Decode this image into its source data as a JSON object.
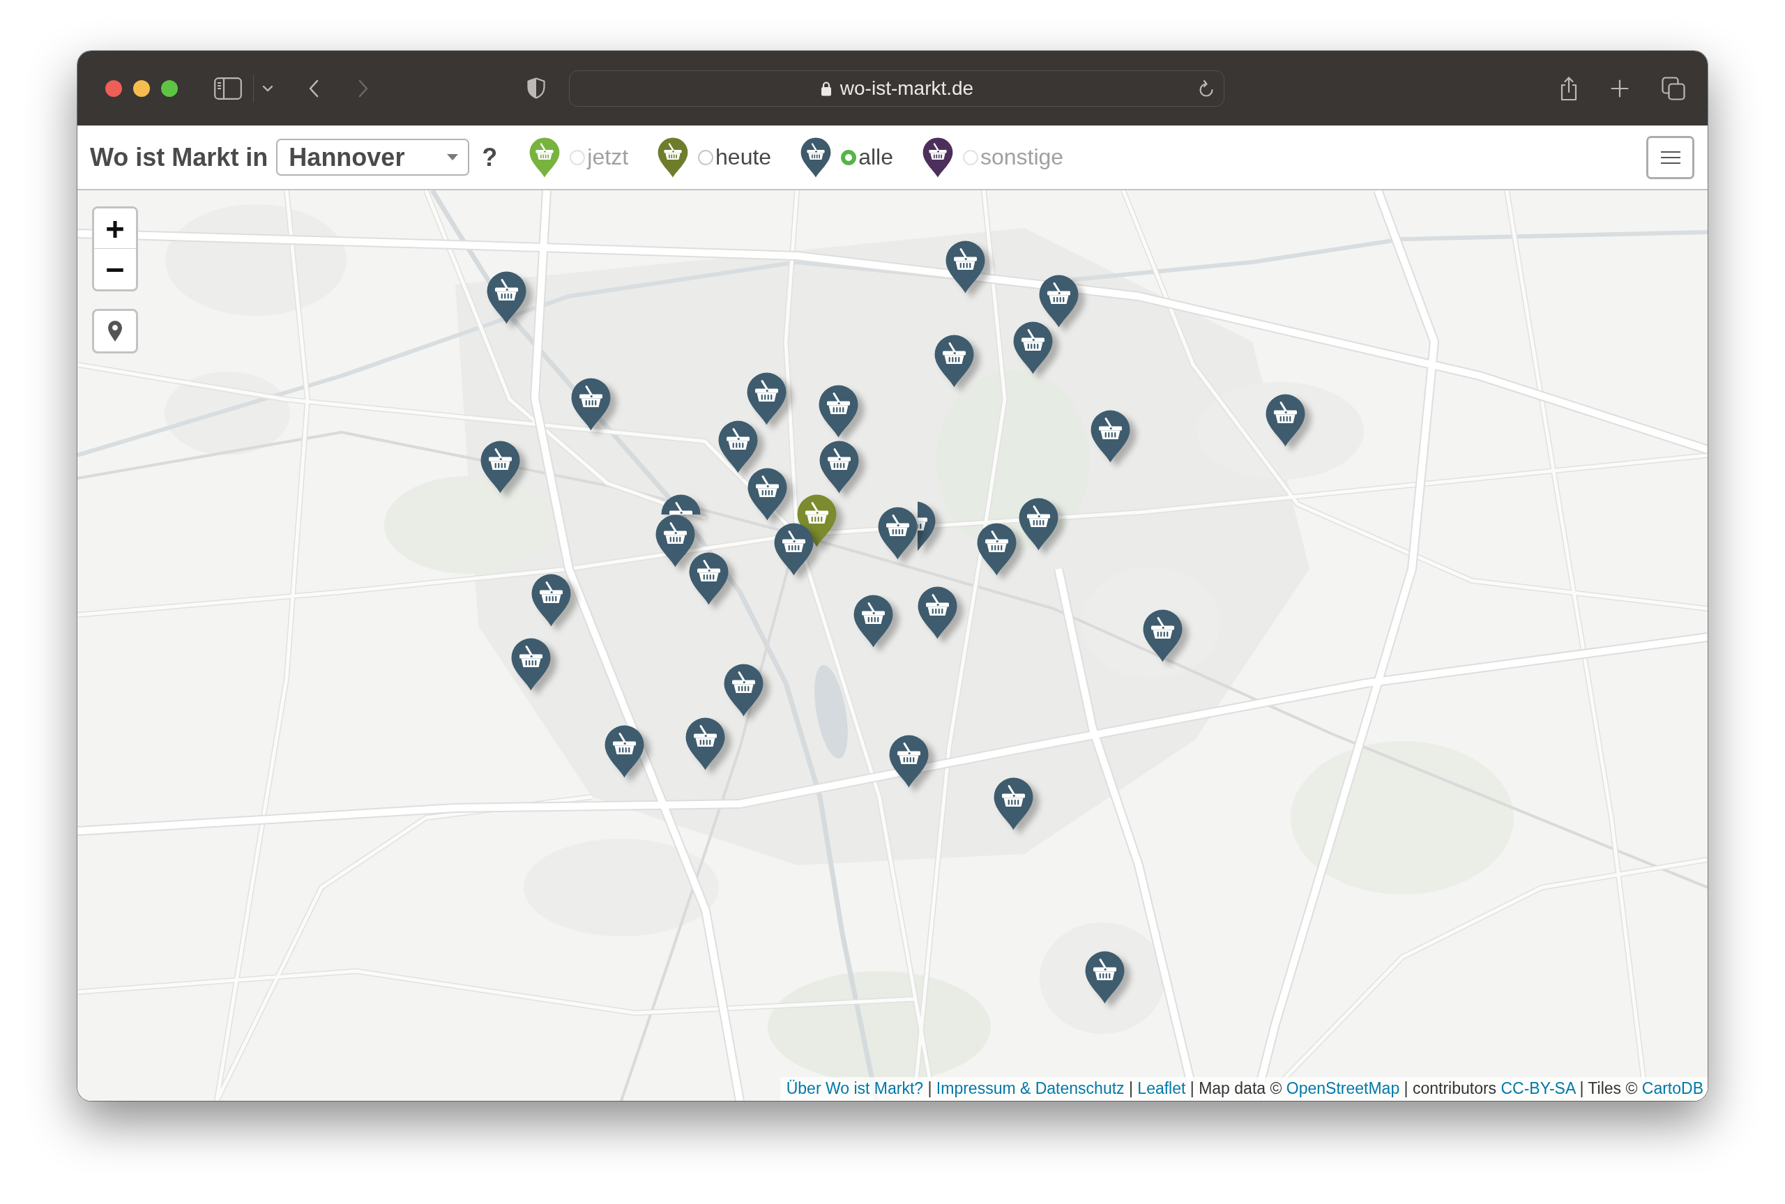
{
  "browser": {
    "url": "wo-ist-markt.de",
    "navigation": [
      {
        "kind": "back",
        "disabled": false
      },
      {
        "kind": "forward",
        "disabled": true
      }
    ]
  },
  "header": {
    "title": "Wo ist Markt in",
    "city_select": {
      "value": "Hannover"
    },
    "help": "?",
    "legend": [
      {
        "label": "jetzt",
        "color": "#79b33f",
        "selected": false,
        "disabled": true
      },
      {
        "label": "heute",
        "color": "#6e7d2c",
        "selected": false,
        "disabled": false
      },
      {
        "label": "alle",
        "color": "#3e5a6b",
        "selected": true,
        "disabled": false
      },
      {
        "label": "sonstige",
        "color": "#4d2f5c",
        "selected": false,
        "disabled": true
      }
    ]
  },
  "map": {
    "controls": {
      "zoom_in": "+",
      "zoom_out": "−"
    },
    "markers": [
      {
        "color": "#3e5c6e"
      },
      {
        "color": "#3e5c6e"
      },
      {
        "color": "#3e5c6e"
      },
      {
        "color": "#3e5c6e"
      },
      {
        "color": "#3e5c6e"
      },
      {
        "color": "#3e5c6e"
      },
      {
        "color": "#3e5c6e"
      },
      {
        "color": "#3e5c6e"
      },
      {
        "color": "#3e5c6e"
      },
      {
        "color": "#3e5c6e"
      },
      {
        "color": "#3e5c6e"
      },
      {
        "color": "#3e5c6e"
      },
      {
        "color": "#3e5c6e"
      },
      {
        "color": "#3e5c6e"
      },
      {
        "color": "#3e5c6e"
      },
      {
        "color": "#3e5c6e"
      },
      {
        "color": "#7b8b2d"
      },
      {
        "color": "#3e5c6e"
      },
      {
        "color": "#3e5c6e"
      },
      {
        "color": "#3e5c6e"
      },
      {
        "color": "#3e5c6e"
      },
      {
        "color": "#3e5c6e"
      },
      {
        "color": "#3e5c6e"
      },
      {
        "color": "#3e5c6e"
      },
      {
        "color": "#3e5c6e"
      },
      {
        "color": "#3e5c6e"
      },
      {
        "color": "#3e5c6e"
      },
      {
        "color": "#3e5c6e"
      },
      {
        "color": "#3e5c6e"
      },
      {
        "color": "#3e5c6e"
      },
      {
        "color": "#3e5c6e"
      },
      {
        "color": "#3e5c6e"
      },
      {
        "color": "#3e5c6e"
      },
      {
        "color": "#3e5c6e"
      }
    ],
    "attribution": [
      {
        "kind": "link",
        "text": "Über Wo ist Markt?"
      },
      {
        "kind": "text",
        "text": "|"
      },
      {
        "kind": "link",
        "text": "Impressum & Datenschutz"
      },
      {
        "kind": "text",
        "text": "|"
      },
      {
        "kind": "link",
        "text": "Leaflet"
      },
      {
        "kind": "text",
        "text": "| Map data ©"
      },
      {
        "kind": "link",
        "text": "OpenStreetMap"
      },
      {
        "kind": "text",
        "text": "| contributors"
      },
      {
        "kind": "link",
        "text": "CC-BY-SA"
      },
      {
        "kind": "text",
        "text": "| Tiles ©"
      },
      {
        "kind": "link",
        "text": "CartoDB"
      }
    ]
  }
}
